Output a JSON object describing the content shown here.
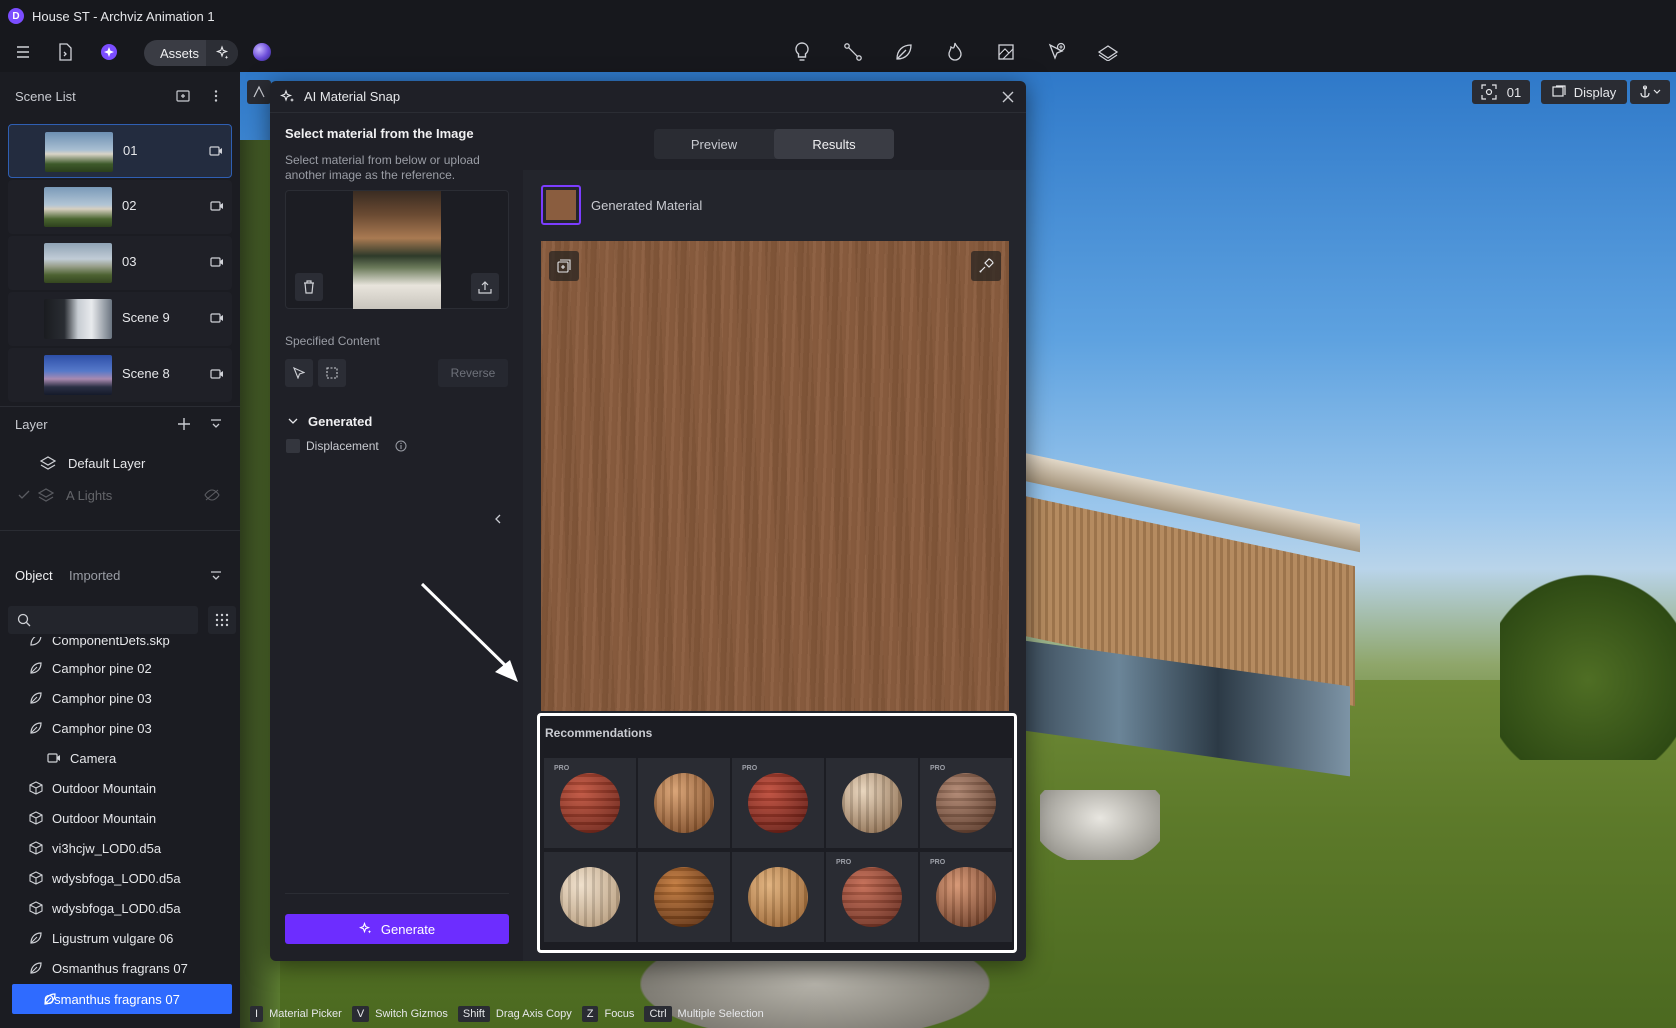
{
  "window": {
    "title": "House ST - Archviz Animation 1",
    "logo": "D"
  },
  "toolbar": {
    "assets_label": "Assets"
  },
  "scene_list": {
    "title": "Scene List",
    "items": [
      {
        "label": "01",
        "active": true
      },
      {
        "label": "02",
        "active": false
      },
      {
        "label": "03",
        "active": false
      },
      {
        "label": "Scene 9",
        "active": false
      },
      {
        "label": "Scene 8",
        "active": false
      }
    ]
  },
  "layers": {
    "title": "Layer",
    "items": [
      {
        "label": "Default Layer"
      },
      {
        "label": "A Lights"
      }
    ]
  },
  "objects": {
    "tab_object": "Object",
    "tab_imported": "Imported",
    "truncated_item": "ComponentDefs.skp",
    "items": [
      {
        "label": "Camphor pine 02",
        "icon": "leaf-icon"
      },
      {
        "label": "Camphor pine 03",
        "icon": "leaf-icon"
      },
      {
        "label": "Camphor pine 03",
        "icon": "leaf-icon"
      },
      {
        "label": "Camera",
        "icon": "camera-icon"
      },
      {
        "label": "Outdoor Mountain",
        "icon": "cube-icon"
      },
      {
        "label": "Outdoor Mountain",
        "icon": "cube-icon"
      },
      {
        "label": "vi3hcjw_LOD0.d5a",
        "icon": "cube-icon"
      },
      {
        "label": "wdysbfoga_LOD0.d5a",
        "icon": "cube-icon"
      },
      {
        "label": "wdysbfoga_LOD0.d5a",
        "icon": "cube-icon"
      },
      {
        "label": "Ligustrum vulgare 06",
        "icon": "leaf-icon"
      },
      {
        "label": "Osmanthus fragrans 07",
        "icon": "leaf-icon"
      },
      {
        "label": "Osmanthus fragrans 07",
        "icon": "leaf-icon",
        "active": true
      }
    ]
  },
  "viewport": {
    "scene_label": "01",
    "display_label": "Display"
  },
  "dialog": {
    "title": "AI Material Snap",
    "select_heading": "Select material from the Image",
    "select_desc_line1": "Select material from below or upload",
    "select_desc_line2": "another image as the reference.",
    "specified_content": "Specified Content",
    "reverse": "Reverse",
    "generated_section": "Generated",
    "displacement": "Displacement",
    "generate_button": "Generate",
    "tabs": [
      "Preview",
      "Results"
    ],
    "active_tab": "Results",
    "generated_material_label": "Generated Material",
    "recommendations_title": "Recommendations",
    "pro_label": "PRO",
    "recommendations": [
      {
        "pro": true,
        "color_a": "#c2543e",
        "color_b": "#6e2418"
      },
      {
        "pro": false,
        "color_a": "#d8a070",
        "color_b": "#7d4a25"
      },
      {
        "pro": true,
        "color_a": "#c04c3a",
        "color_b": "#651c14"
      },
      {
        "pro": false,
        "color_a": "#e8d4bb",
        "color_b": "#8a6a4c"
      },
      {
        "pro": true,
        "color_a": "#b08670",
        "color_b": "#5a3828"
      },
      {
        "pro": false,
        "color_a": "#efdfca",
        "color_b": "#b59a7a"
      },
      {
        "pro": false,
        "color_a": "#c47a3c",
        "color_b": "#5c2e10"
      },
      {
        "pro": false,
        "color_a": "#e0b07a",
        "color_b": "#9a6432"
      },
      {
        "pro": true,
        "color_a": "#c46a52",
        "color_b": "#6a2e20"
      },
      {
        "pro": true,
        "color_a": "#d69470",
        "color_b": "#6a3a24"
      }
    ],
    "material_swatch_color": "#8a5d3f"
  },
  "statusbar": {
    "hints": [
      {
        "key": "I",
        "label": "Material Picker"
      },
      {
        "key": "V",
        "label": "Switch Gizmos"
      },
      {
        "key": "Shift",
        "label": "Drag Axis Copy"
      },
      {
        "key": "Z",
        "label": "Focus"
      },
      {
        "key": "Ctrl",
        "label": "Multiple Selection"
      }
    ]
  },
  "colors": {
    "accent": "#6d2dff",
    "selection": "#2f6bff"
  }
}
